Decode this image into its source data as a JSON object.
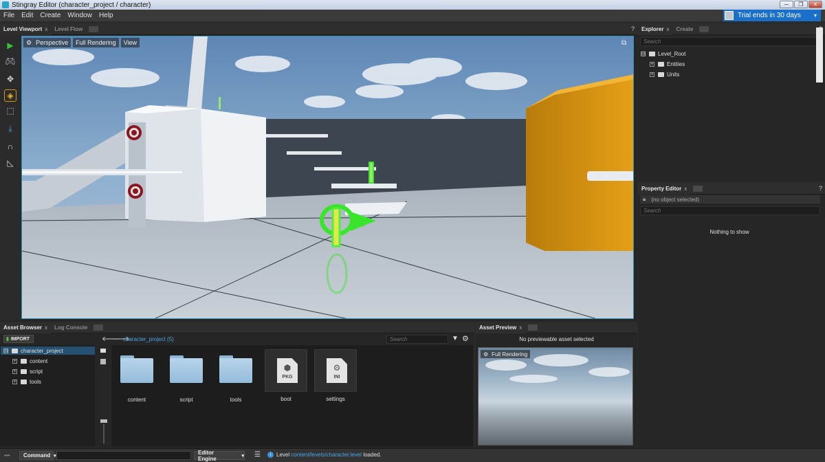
{
  "window": {
    "title": "Stingray Editor (character_project / character)",
    "minimize": "─",
    "maximize": "❐",
    "close": "✕"
  },
  "menu": [
    "File",
    "Edit",
    "Create",
    "Window",
    "Help"
  ],
  "trial": {
    "label": "Trial ends in 30 days",
    "arrow": "▾"
  },
  "viewport": {
    "tabs": [
      {
        "label": "Level Viewport",
        "close": "x"
      },
      {
        "label": "Level Flow"
      }
    ],
    "help": "?",
    "toolbar": {
      "perspective": "Perspective",
      "rendering": "Full Rendering",
      "view": "View"
    },
    "tools": [
      "play-icon",
      "gamepad-icon",
      "move-icon",
      "rotate-icon",
      "scale-icon",
      "snap-down-icon",
      "magnet-grid-icon",
      "ruler-icon"
    ],
    "maximize_icon": "⧉",
    "colors": {
      "highlight": "#2f8fb3",
      "orange_block": "#e6a017",
      "selection_green": "#39e52a"
    }
  },
  "explorer": {
    "tabs": [
      {
        "label": "Explorer",
        "close": "x"
      },
      {
        "label": "Create"
      }
    ],
    "help": "?",
    "search_placeholder": "Search",
    "tree": [
      {
        "label": "Level_Root",
        "toggle": "⊟"
      },
      {
        "label": "Entities",
        "toggle": "+"
      },
      {
        "label": "Units",
        "toggle": "+"
      }
    ]
  },
  "property_editor": {
    "tabs": [
      {
        "label": "Property Editor",
        "close": "x"
      }
    ],
    "help": "?",
    "object": "(no object selected)",
    "search_placeholder": "Search",
    "empty": "Nothing to show"
  },
  "asset_browser": {
    "tabs": [
      {
        "label": "Asset Browser",
        "close": "x"
      },
      {
        "label": "Log Console"
      }
    ],
    "import_button": "IMPORT",
    "path": "character_project (5)",
    "search_placeholder": "Search",
    "tree": [
      {
        "label": "character_project",
        "toggle": "⊟",
        "selected": true
      },
      {
        "label": "content",
        "toggle": "+"
      },
      {
        "label": "script",
        "toggle": "+"
      },
      {
        "label": "tools",
        "toggle": "+"
      }
    ],
    "items": [
      {
        "label": "content",
        "kind": "folder"
      },
      {
        "label": "script",
        "kind": "folder"
      },
      {
        "label": "tools",
        "kind": "folder"
      },
      {
        "label": "boot",
        "kind": "file",
        "ext": "PKG"
      },
      {
        "label": "settings",
        "kind": "file",
        "ext": "INI"
      }
    ]
  },
  "asset_preview": {
    "tabs": [
      {
        "label": "Asset Preview",
        "close": "x"
      }
    ],
    "message": "No previewable asset selected",
    "rendering": "Full Rendering"
  },
  "status": {
    "command_label": "Command",
    "engine_label": "Editor Engine",
    "arrow": "▾",
    "log_prefix": "Level",
    "log_path": "content/levels/character.level",
    "log_suffix": "loaded."
  }
}
